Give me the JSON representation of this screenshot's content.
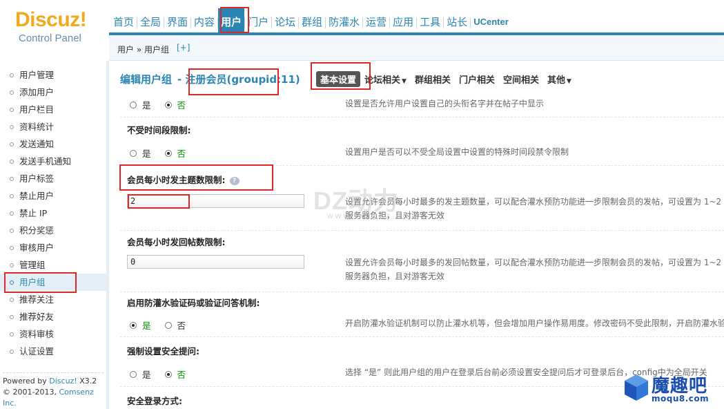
{
  "logo": {
    "brand": "Discuz!",
    "subtitle": "Control Panel"
  },
  "topnav": [
    "首页",
    "全局",
    "界面",
    "内容",
    "用户",
    "门户",
    "论坛",
    "群组",
    "防灌水",
    "运营",
    "应用",
    "工具",
    "站长",
    "UCenter"
  ],
  "topnav_active": "用户",
  "breadcrumb": {
    "path": "用户 » 用户组",
    "expand": "[+]"
  },
  "sidebar": {
    "items": [
      "用户管理",
      "添加用户",
      "用户栏目",
      "资料统计",
      "发送通知",
      "发送手机通知",
      "用户标签",
      "禁止用户",
      "禁止 IP",
      "积分奖惩",
      "审核用户",
      "管理组",
      "用户组",
      "推荐关注",
      "推荐好友",
      "资料审核",
      "认证设置"
    ],
    "active": "用户组",
    "footer": {
      "line1_prefix": "Powered by ",
      "line1_link": "Discuz!",
      "line1_suffix": " X3.2",
      "line2_prefix": "© 2001-2013, ",
      "line2_link": "Comsenz Inc."
    }
  },
  "page": {
    "title": "编辑用户组",
    "group": " - 注册会员(groupid:11)",
    "tabs": [
      {
        "label": "基本设置",
        "dropdown": false,
        "active": true
      },
      {
        "label": "论坛相关",
        "dropdown": true,
        "active": false
      },
      {
        "label": "群组相关",
        "dropdown": false,
        "active": false
      },
      {
        "label": "门户相关",
        "dropdown": false,
        "active": false
      },
      {
        "label": "空间相关",
        "dropdown": false,
        "active": false
      },
      {
        "label": "其他",
        "dropdown": true,
        "active": false
      }
    ]
  },
  "options": {
    "yes": "是",
    "no": "否"
  },
  "rows": {
    "custom_title": {
      "selected": "no",
      "hint": "设置是否允许用户设置自己的头衔名字并在帖子中显示"
    },
    "no_time_limit": {
      "label": "不受时间段限制:",
      "selected": "no",
      "hint": "设置用户是否可以不受全局设置中设置的特殊时间段禁令限制"
    },
    "threads_per_hour": {
      "label": "会员每小时发主题数限制:",
      "help": "?",
      "value": "2",
      "hint1": "设置允许会员每小时最多的发主题数量，可以配合灌水预防功能进一步限制会员的发帖，可设置为 1~2",
      "hint2": "服务器负担，且对游客无效"
    },
    "posts_per_hour": {
      "label": "会员每小时发回帖数限制:",
      "value": "0",
      "hint1": "设置允许会员每小时最多的发回帖数量，可以配合灌水预防功能进一步限制会员的发帖，可设置为 1~2",
      "hint2": "服务器负担，且对游客无效"
    },
    "anti_flood": {
      "label": "启用防灌水验证码或验证问答机制:",
      "selected": "yes",
      "hint": "开启防灌水验证机制可以防止灌水机等，但会增加用户操作易用度。修改密码不受此限制，开启防灌水验"
    },
    "force_question": {
      "label": "强制设置安全提问:",
      "selected": "yes",
      "hint": "选择 “是” 则此用户组的用户在登录后台前必须设置安全提问后才可登录后台，config中为全局开关"
    },
    "secure_login": {
      "label": "安全登录方式:"
    }
  },
  "watermarks": {
    "dz": "DZ动力",
    "dz_url": "www.verydz.com",
    "moqu_big": "魔趣吧",
    "moqu_small": "moqu8.com"
  }
}
